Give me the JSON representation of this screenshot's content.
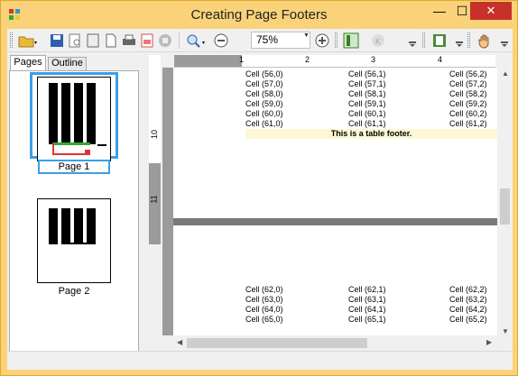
{
  "window": {
    "title": "Creating Page Footers",
    "minimize_glyph": "—",
    "maximize_glyph": "☐",
    "close_glyph": "✕"
  },
  "toolbar": {
    "zoom_value": "75%",
    "icons": [
      "open-icon",
      "save-icon",
      "print-preview-icon",
      "page-setup-icon",
      "new-page-icon",
      "print-icon",
      "export-icon",
      "stop-icon",
      "zoom-in-icon",
      "zoom-out-icon",
      "zoom-plus-icon",
      "thumbnails-icon",
      "navigation-icon",
      "outline-icon",
      "hand-tool-icon"
    ]
  },
  "tabs": [
    {
      "label": "Pages"
    },
    {
      "label": "Outline"
    }
  ],
  "thumbnails": [
    {
      "label": "Page 1"
    },
    {
      "label": "Page 2"
    }
  ],
  "ruler": {
    "h_marks": [
      "1",
      "2",
      "3",
      "4"
    ],
    "v_marks": [
      "10",
      "11"
    ]
  },
  "page1_rows": [
    [
      "Cell (56,0)",
      "Cell (56,1)",
      "Cell (56,2)"
    ],
    [
      "Cell (57,0)",
      "Cell (57,1)",
      "Cell (57,2)"
    ],
    [
      "Cell (58,0)",
      "Cell (58,1)",
      "Cell (58,2)"
    ],
    [
      "Cell (59,0)",
      "Cell (59,1)",
      "Cell (59,2)"
    ],
    [
      "Cell (60,0)",
      "Cell (60,1)",
      "Cell (60,2)"
    ],
    [
      "Cell (61,0)",
      "Cell (61,1)",
      "Cell (61,2)"
    ]
  ],
  "table_footer": "This is a table footer.",
  "page2_rows": [
    [
      "Cell (62,0)",
      "Cell (62,1)",
      "Cell (62,2)"
    ],
    [
      "Cell (63,0)",
      "Cell (63,1)",
      "Cell (63,2)"
    ],
    [
      "Cell (64,0)",
      "Cell (64,1)",
      "Cell (64,2)"
    ],
    [
      "Cell (65,0)",
      "Cell (65,1)",
      "Cell (65,2)"
    ]
  ],
  "colors": {
    "title_bar": "#f9d27a",
    "close": "#c7312a",
    "selection": "#3d9ee7",
    "footer_band": "#fdf8d4"
  }
}
